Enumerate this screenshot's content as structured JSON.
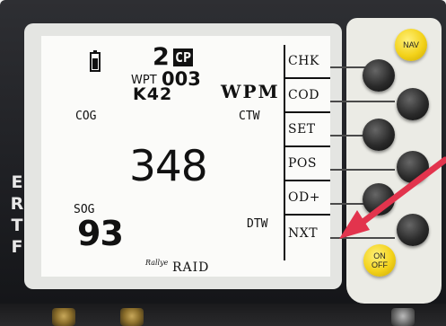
{
  "bezel": {
    "side_letters": [
      "E",
      "R",
      "T",
      "F"
    ]
  },
  "screen": {
    "battery_icon": "battery-icon",
    "waypoint_count": "2",
    "cp_badge": "CP",
    "wpt_label": "WPT",
    "wpt_number": "003",
    "waypoint_name": "K42",
    "mode": "WPM",
    "left_top_label": "COG",
    "right_top_label": "CTW",
    "main_value": "348",
    "bottom_left_label": "SOG",
    "bottom_left_value": "93",
    "bottom_right_label": "DTW",
    "brand_script": "Rallye",
    "brand_name": "RAID"
  },
  "menu": {
    "items": [
      "CHK",
      "COD",
      "SET",
      "POS",
      "OD+",
      "NXT"
    ]
  },
  "panel": {
    "nav_label": "NAV",
    "onoff_label_on": "ON",
    "onoff_label_off": "OFF",
    "colors": {
      "accent_yellow": "#f3d21a",
      "arrow": "#e2344d"
    }
  }
}
